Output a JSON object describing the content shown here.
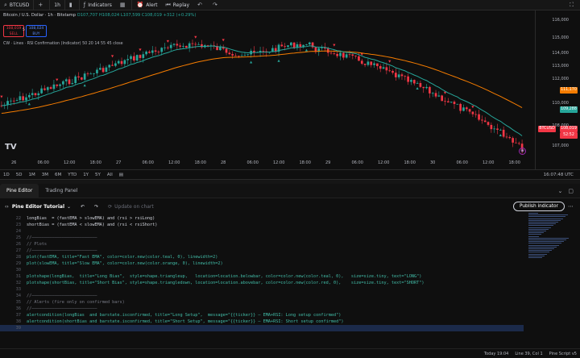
{
  "topbar": {
    "symbol": "BTCUSD",
    "interval": "1h",
    "indicators_label": "Indicators",
    "alert_label": "Alert",
    "replay_label": "Replay"
  },
  "legend": {
    "symbol_line": "Bitcoin / U.S. Dollar · 1h · Bitstamp",
    "ohlc": "O107,707 H108,024 L107,599 C108,019 +312 (+0.29%)",
    "sell_price": "108,019",
    "sell_label": "SELL",
    "mid_value": "5",
    "buy_price": "108,024",
    "buy_label": "BUY",
    "indicator_line": "CW · Lines · RSI Confirmation (Indicator) 50 20 14 55 45 close"
  },
  "y_axis": {
    "ticks": [
      "116,000",
      "115,000",
      "114,000",
      "113,000",
      "112,000",
      "111,000",
      "110,000",
      "109,000",
      "108,000",
      "107,000"
    ],
    "labels": [
      {
        "text": "111,170",
        "color": "#f57c00"
      },
      {
        "text": "109,288",
        "color": "#26a69a"
      },
      {
        "text": "BTCUSD",
        "color": "#f23645"
      },
      {
        "text": "108,019",
        "color": "#f23645"
      },
      {
        "text": "52:52",
        "color": "#f23645"
      }
    ]
  },
  "x_axis": {
    "ticks": [
      "26",
      "06:00",
      "12:00",
      "18:00",
      "27",
      "06:00",
      "12:00",
      "18:00",
      "28",
      "06:00",
      "12:00",
      "18:00",
      "29",
      "06:00",
      "12:00",
      "18:00",
      "30",
      "06:00",
      "12:00",
      "18:00"
    ]
  },
  "rangebar": {
    "ranges": [
      "1D",
      "5D",
      "1M",
      "3M",
      "6M",
      "YTD",
      "1Y",
      "5Y",
      "All"
    ],
    "time": "16:07:48 UTC"
  },
  "editor": {
    "tabs": [
      "Pine Editor",
      "Trading Panel"
    ],
    "script_name": "Pine Editor Tutorial",
    "update_label": "Update on chart",
    "publish_label": "Publish indicator",
    "lines": [
      {
        "n": "22",
        "text": "longBias  = (fastEMA > slowEMA) and (rsi > rsiLong)"
      },
      {
        "n": "23",
        "text": "shortBias = (fastEMA < slowEMA) and (rsi < rsiShort)"
      },
      {
        "n": "24",
        "text": ""
      },
      {
        "n": "25",
        "text": "//——————————————————————————"
      },
      {
        "n": "26",
        "text": "// Plots"
      },
      {
        "n": "27",
        "text": "//——————————————————————————"
      },
      {
        "n": "28",
        "text": "plot(fastEMA, title=\"Fast EMA\", color=color.new(color.teal, 0), linewidth=2)"
      },
      {
        "n": "29",
        "text": "plot(slowEMA, title=\"Slow EMA\", color=color.new(color.orange, 0), linewidth=2)"
      },
      {
        "n": "30",
        "text": ""
      },
      {
        "n": "31",
        "text": "plotshape(longBias,  title=\"Long Bias\",  style=shape.triangleup,   location=location.belowbar, color=color.new(color.teal, 0),   size=size.tiny, text=\"LONG\")"
      },
      {
        "n": "32",
        "text": "plotshape(shortBias, title=\"Short Bias\", style=shape.triangledown, location=location.abovebar, color=color.new(color.red, 0),    size=size.tiny, text=\"SHORT\")"
      },
      {
        "n": "33",
        "text": ""
      },
      {
        "n": "34",
        "text": "//——————————————————————————"
      },
      {
        "n": "35",
        "text": "// Alerts (fire only on confirmed bars)"
      },
      {
        "n": "36",
        "text": "//——————————————————————————"
      },
      {
        "n": "37",
        "text": "alertcondition(longBias  and barstate.isconfirmed, title=\"Long Setup\",  message=\"{{ticker}} — EMA+RSI: Long setup confirmed\")"
      },
      {
        "n": "38",
        "text": "alertcondition(shortBias and barstate.isconfirmed, title=\"Short Setup\", message=\"{{ticker}} — EMA+RSI: Short setup confirmed\")"
      },
      {
        "n": "39",
        "text": ""
      }
    ],
    "status": [
      "Today 19:04",
      "Line 39, Col 1",
      "Pine Script v5"
    ]
  },
  "colors": {
    "teal": "#26a69a",
    "red": "#f23645",
    "orange": "#f57c00",
    "blue": "#2962ff"
  }
}
